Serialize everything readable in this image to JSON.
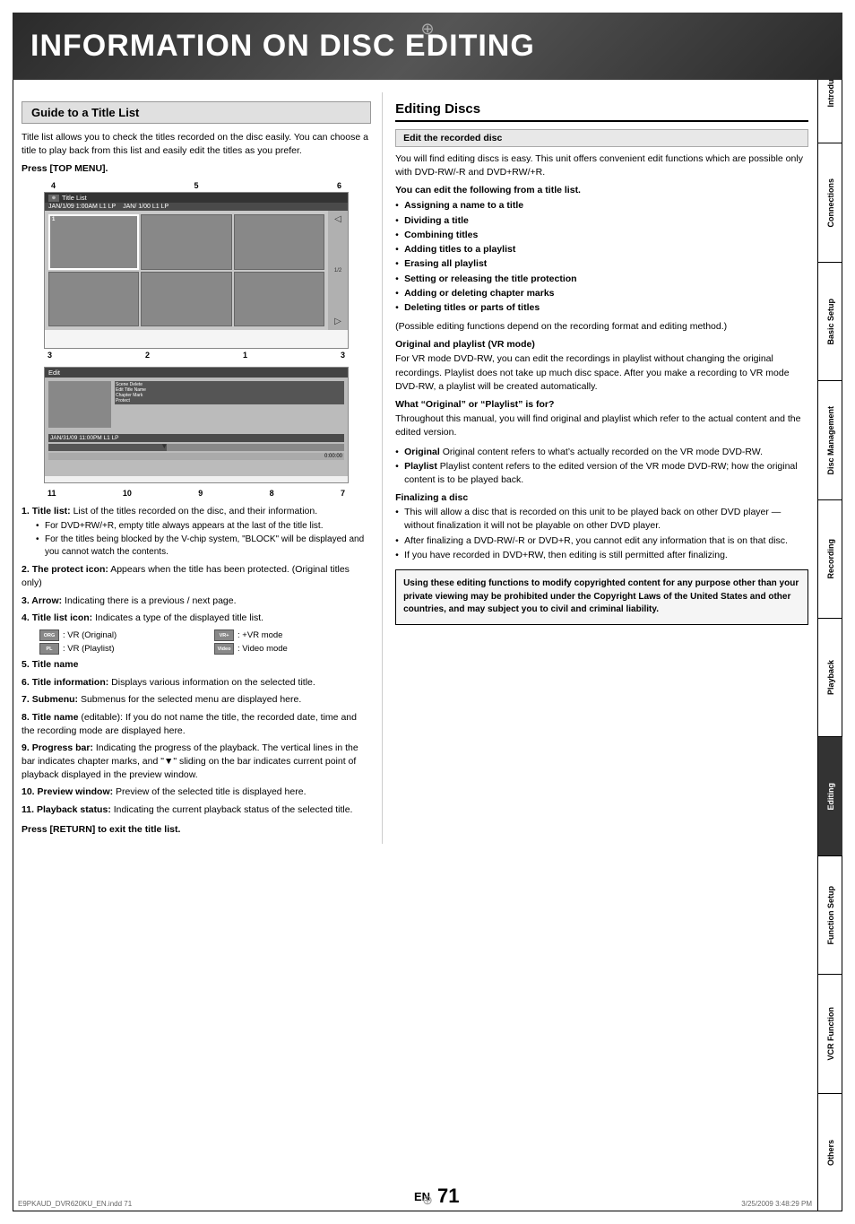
{
  "header": {
    "title": "INFORMATION ON DISC EDITING"
  },
  "left_section": {
    "title": "Guide to a Title List",
    "intro": "Title list allows you to check the titles recorded on the disc easily. You can choose a title to play back from this list and easily edit the titles as you prefer.",
    "press_instruction": "Press [TOP MENU].",
    "diagram_labels_top": [
      "4",
      "5",
      "6"
    ],
    "diagram_labels_bottom": [
      "3",
      "2",
      "1",
      "3"
    ],
    "diagram2_labels_bottom": [
      "11",
      "10",
      "9",
      "8",
      "7"
    ],
    "numbered_items": [
      {
        "num": "1",
        "label": "Title list:",
        "text": " List of the titles recorded on the disc, and their information.",
        "sub_bullets": [
          "For DVD+RW/+R, empty title always appears at the last of the title list.",
          "For the titles being blocked by the V-chip system, \"BLOCK\" will be displayed and you cannot watch the contents."
        ]
      },
      {
        "num": "2",
        "label": "The protect icon:",
        "text": " Appears when the title has been protected. (Original titles only)"
      },
      {
        "num": "3",
        "label": "Arrow:",
        "text": " Indicating there is a previous / next page."
      },
      {
        "num": "4",
        "label": "Title list icon:",
        "text": " Indicates a type of the displayed title list."
      }
    ],
    "icon_modes": [
      {
        "icon": "ORG",
        "label": ": VR (Original)"
      },
      {
        "icon": "VR+",
        "label": ": +VR mode"
      },
      {
        "icon": "PL",
        "label": ": VR (Playlist)"
      },
      {
        "icon": "Video",
        "label": ": Video mode"
      }
    ],
    "item5": {
      "num": "5",
      "label": "Title name"
    },
    "item6": {
      "num": "6",
      "label": "Title information:",
      "text": " Displays various information on the selected title."
    },
    "item7": {
      "num": "7",
      "label": "Submenu:",
      "text": " Submenus for the selected menu are displayed here."
    },
    "item8": {
      "num": "8",
      "label": "Title name",
      "text": " (editable): If you do not name the title, the recorded date, time and the recording mode are displayed here."
    },
    "item9": {
      "num": "9",
      "label": "Progress bar:",
      "text": " Indicating the progress of the playback. The vertical lines in the bar indicates chapter marks, and \"▼\" sliding on the bar indicates current point of playback displayed in the preview window."
    },
    "item10": {
      "num": "10",
      "label": "Preview window:",
      "text": " Preview of the selected title is displayed here."
    },
    "item11": {
      "num": "11",
      "label": "Playback status:",
      "text": " Indicating the current playback status of the selected title."
    },
    "press_return": "Press [RETURN] to exit the title list."
  },
  "right_section": {
    "title": "Editing Discs",
    "subsection": "Edit the recorded disc",
    "intro": "You will find editing discs is easy. This unit offers convenient edit functions which are possible only with DVD-RW/-R and DVD+RW/+R.",
    "bold_label": "You can edit the following from a title list.",
    "bullets": [
      "Assigning a name to a title",
      "Dividing a title",
      "Combining titles",
      "Adding titles to a playlist",
      "Erasing all playlist",
      "Setting or releasing the title protection",
      "Adding or deleting chapter marks",
      "Deleting titles or parts of titles"
    ],
    "possible_note": "(Possible editing functions depend on the recording format and editing method.)",
    "original_playlist_title": "Original and playlist (VR mode)",
    "original_playlist_text": "For VR mode DVD-RW, you can edit the recordings in playlist without changing the original recordings. Playlist does not take up much disc space. After you make a recording to VR mode DVD-RW, a playlist will be created automatically.",
    "what_title": "What “Original” or “Playlist” is for?",
    "what_text": "Throughout this manual, you will find original and playlist which refer to the actual content and the edited version.",
    "original_bullet": "Original content refers to what’s actually recorded on the VR mode DVD-RW.",
    "playlist_bullet": "Playlist content refers to the edited version of the VR mode DVD-RW; how the original content is to be played back.",
    "finalizing_title": "Finalizing a disc",
    "finalizing_bullets": [
      "This will allow a disc that is recorded on this unit to be played back on other DVD player — without finalization it will not be playable on other DVD player.",
      "After finalizing a DVD-RW/-R or DVD+R, you cannot edit any information that is on that disc.",
      "If you have recorded in DVD+RW, then editing is still permitted after finalizing."
    ],
    "warning_text": "Using these editing functions to modify copyrighted content for any purpose other than your private viewing may be prohibited under the Copyright Laws of the United States and other countries, and may subject you to civil and criminal liability."
  },
  "sidebar": {
    "sections": [
      {
        "label": "Introduction",
        "active": false
      },
      {
        "label": "Connections",
        "active": false
      },
      {
        "label": "Basic Setup",
        "active": false
      },
      {
        "label": "Disc Management",
        "active": false
      },
      {
        "label": "Recording",
        "active": false
      },
      {
        "label": "Playback",
        "active": false
      },
      {
        "label": "Editing",
        "active": true
      },
      {
        "label": "Function Setup",
        "active": false
      },
      {
        "label": "VCR Function",
        "active": false
      },
      {
        "label": "Others",
        "active": false
      }
    ]
  },
  "footer": {
    "file_info": "E9PKAUD_DVR620KU_EN.indd  71",
    "en_label": "EN",
    "page_number": "71",
    "date": "3/25/2009  3:48:29 PM"
  }
}
